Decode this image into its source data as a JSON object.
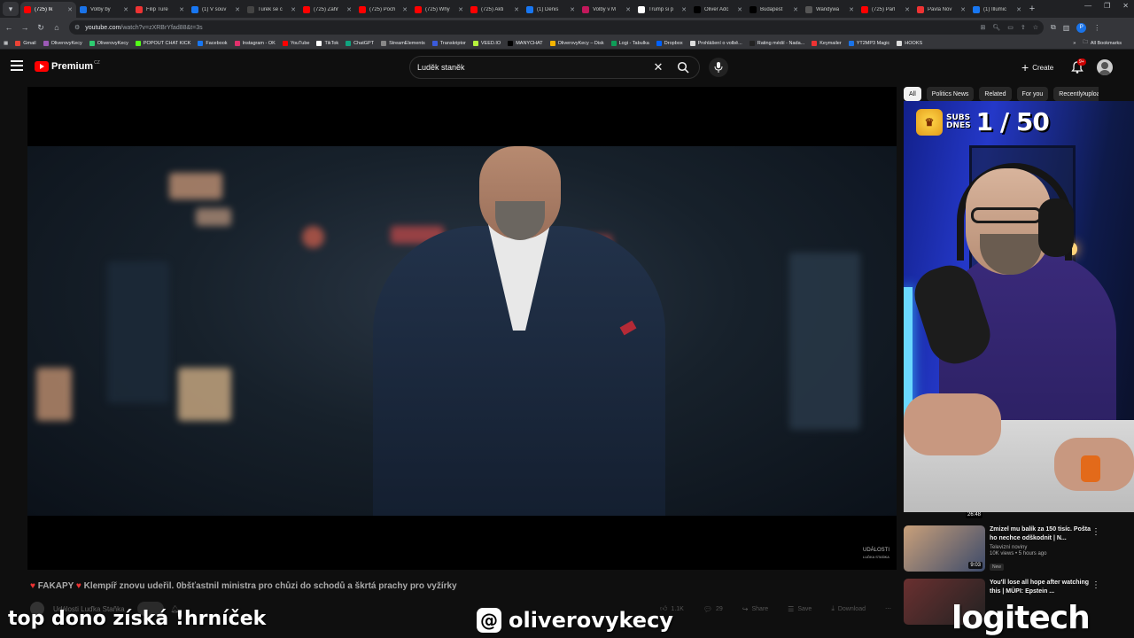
{
  "browser": {
    "tabs": [
      {
        "label": "(725) Ik",
        "color": "#ff0000",
        "active": true
      },
      {
        "label": "Volby by",
        "color": "#1a73e8"
      },
      {
        "label": "Filip Ture",
        "color": "#e33"
      },
      {
        "label": "(1) V souv",
        "color": "#1877f2"
      },
      {
        "label": "Turek se c",
        "color": "#444"
      },
      {
        "label": "(725) Zahr",
        "color": "#ff0000"
      },
      {
        "label": "(725) Poch",
        "color": "#ff0000"
      },
      {
        "label": "(725) Why",
        "color": "#ff0000"
      },
      {
        "label": "(725) Akti",
        "color": "#ff0000"
      },
      {
        "label": "(1) Denis",
        "color": "#1877f2"
      },
      {
        "label": "Volby v M",
        "color": "#c2185b"
      },
      {
        "label": "Trump si p",
        "color": "#fff"
      },
      {
        "label": "Oliver Adc",
        "color": "#000"
      },
      {
        "label": "Budapest",
        "color": "#000"
      },
      {
        "label": "Wandywa",
        "color": "#555"
      },
      {
        "label": "(725) Parl",
        "color": "#ff0000"
      },
      {
        "label": "Pavla Nov",
        "color": "#e33"
      },
      {
        "label": "(1) Illumic",
        "color": "#1877f2"
      }
    ],
    "new_tab": "+",
    "url_main": "youtube.com",
    "url_rest": "/watch?v=zXRBrYfad88&t=3s",
    "profile_letter": "P",
    "bookmarks": [
      {
        "label": "Gmail",
        "color": "#ea4335"
      },
      {
        "label": "OliverovyKecy",
        "color": "#9b59b6"
      },
      {
        "label": "OliverovyKecy",
        "color": "#2ecc71"
      },
      {
        "label": "POPOUT CHAT KICK",
        "color": "#53fc18"
      },
      {
        "label": "Facebook",
        "color": "#1877f2"
      },
      {
        "label": "Instagram - OK",
        "color": "#e1306c"
      },
      {
        "label": "YouTube",
        "color": "#ff0000"
      },
      {
        "label": "TikTok",
        "color": "#fff"
      },
      {
        "label": "ChatGPT",
        "color": "#10a37f"
      },
      {
        "label": "StreamElements",
        "color": "#888"
      },
      {
        "label": "Transkriptor",
        "color": "#3b5bdb"
      },
      {
        "label": "VEED.IO",
        "color": "#b5f23d"
      },
      {
        "label": "MANYCHAT",
        "color": "#000"
      },
      {
        "label": "OliverovyKecy – Disk",
        "color": "#f4b400"
      },
      {
        "label": "Logi - Tabulka",
        "color": "#0f9d58"
      },
      {
        "label": "Dropbox",
        "color": "#0061ff"
      },
      {
        "label": "Prohlášení o volbě...",
        "color": "#ddd"
      },
      {
        "label": "Rating médií - Nada...",
        "color": "#222"
      },
      {
        "label": "Keymailer",
        "color": "#e33"
      },
      {
        "label": "YT2MP3 Magic",
        "color": "#1a73e8"
      },
      {
        "label": "HOOKS",
        "color": "#ddd"
      }
    ],
    "all_bookmarks": "All Bookmarks"
  },
  "youtube": {
    "logo_text": "Premium",
    "country": "CZ",
    "search_value": "Luděk staněk",
    "create_label": "Create",
    "notifications_badge": "9+"
  },
  "video": {
    "title_prefix": "FAKAPY",
    "title": "Klempíř znovu udeřil. 0bšťastnil ministra pro chůzi do schodů a škrtá prachy pro vyžírky",
    "channel": "Události Luďka Staňka",
    "likes": "1.1K",
    "comments": "29",
    "share_label": "Share",
    "save_label": "Save",
    "download_label": "Download",
    "watermark_line1": "UDÁLOSTI",
    "watermark_line2": "LUĎKA STAŇKA"
  },
  "chips": [
    {
      "label": "All",
      "active": true
    },
    {
      "label": "Politics News"
    },
    {
      "label": "Related"
    },
    {
      "label": "For you"
    },
    {
      "label": "Recently uploaded"
    }
  ],
  "recommendations": [
    {
      "title": "Zmizel mu balík za 150 tisíc. Pošta ho nechce odškodnit | N...",
      "channel": "Televizní noviny",
      "meta": "10K views • 5 hours ago",
      "badge": "New",
      "duration": "9:03",
      "thumb_colors": [
        "#c9a07a",
        "#3c4a6a"
      ]
    },
    {
      "title": "You'll lose all hope after watching this | MÜPI: Epstein ...",
      "channel": "",
      "meta": "",
      "badge": "",
      "duration": "",
      "thumb_colors": [
        "#6a3030",
        "#222"
      ]
    }
  ],
  "previous_duration": "26:48",
  "stream": {
    "subs_label_line1": "SUBS",
    "subs_label_line2": "DNES",
    "subs_count": "1 / 50",
    "bottom_left": "top dono získá !hrníček",
    "threads_handle": "oliverovykecy",
    "logitech": "logitech"
  }
}
